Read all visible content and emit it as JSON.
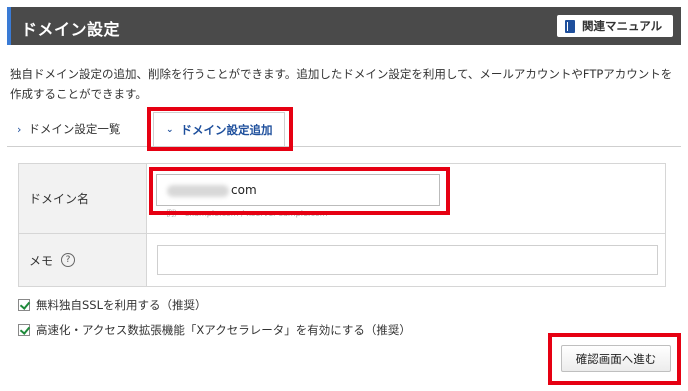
{
  "header": {
    "title": "ドメイン設定",
    "manual_label": "関連マニュアル"
  },
  "description": "独自ドメイン設定の追加、削除を行うことができます。追加したドメイン設定を利用して、メールアカウントやFTPアカウントを作成することができます。",
  "tabs": [
    {
      "label": "ドメイン設定一覧",
      "active": false
    },
    {
      "label": "ドメイン設定追加",
      "active": true
    }
  ],
  "form": {
    "domain_label": "ドメイン名",
    "domain_suffix": "com",
    "domain_example": "例） example.com / xserver-sample.com",
    "memo_label": "メモ",
    "memo_value": "",
    "help_icon": "?"
  },
  "options": {
    "ssl_label": "無料独自SSLを利用する（推奨）",
    "ssl_checked": true,
    "accel_label": "高速化・アクセス数拡張機能「Xアクセラレータ」を有効にする（推奨）",
    "accel_checked": true
  },
  "actions": {
    "confirm_label": "確認画面へ進む"
  },
  "icons": {
    "manual": "book-icon",
    "tab_list": "chevron-right-icon",
    "tab_add": "chevron-down-icon",
    "help": "question-circle-icon",
    "check": "checkbox-checked-icon"
  },
  "colors": {
    "header_bg": "#4a4a4a",
    "accent_blue": "#1e4f9c",
    "highlight_red": "#e60012",
    "check_green": "#1e8a3a"
  }
}
